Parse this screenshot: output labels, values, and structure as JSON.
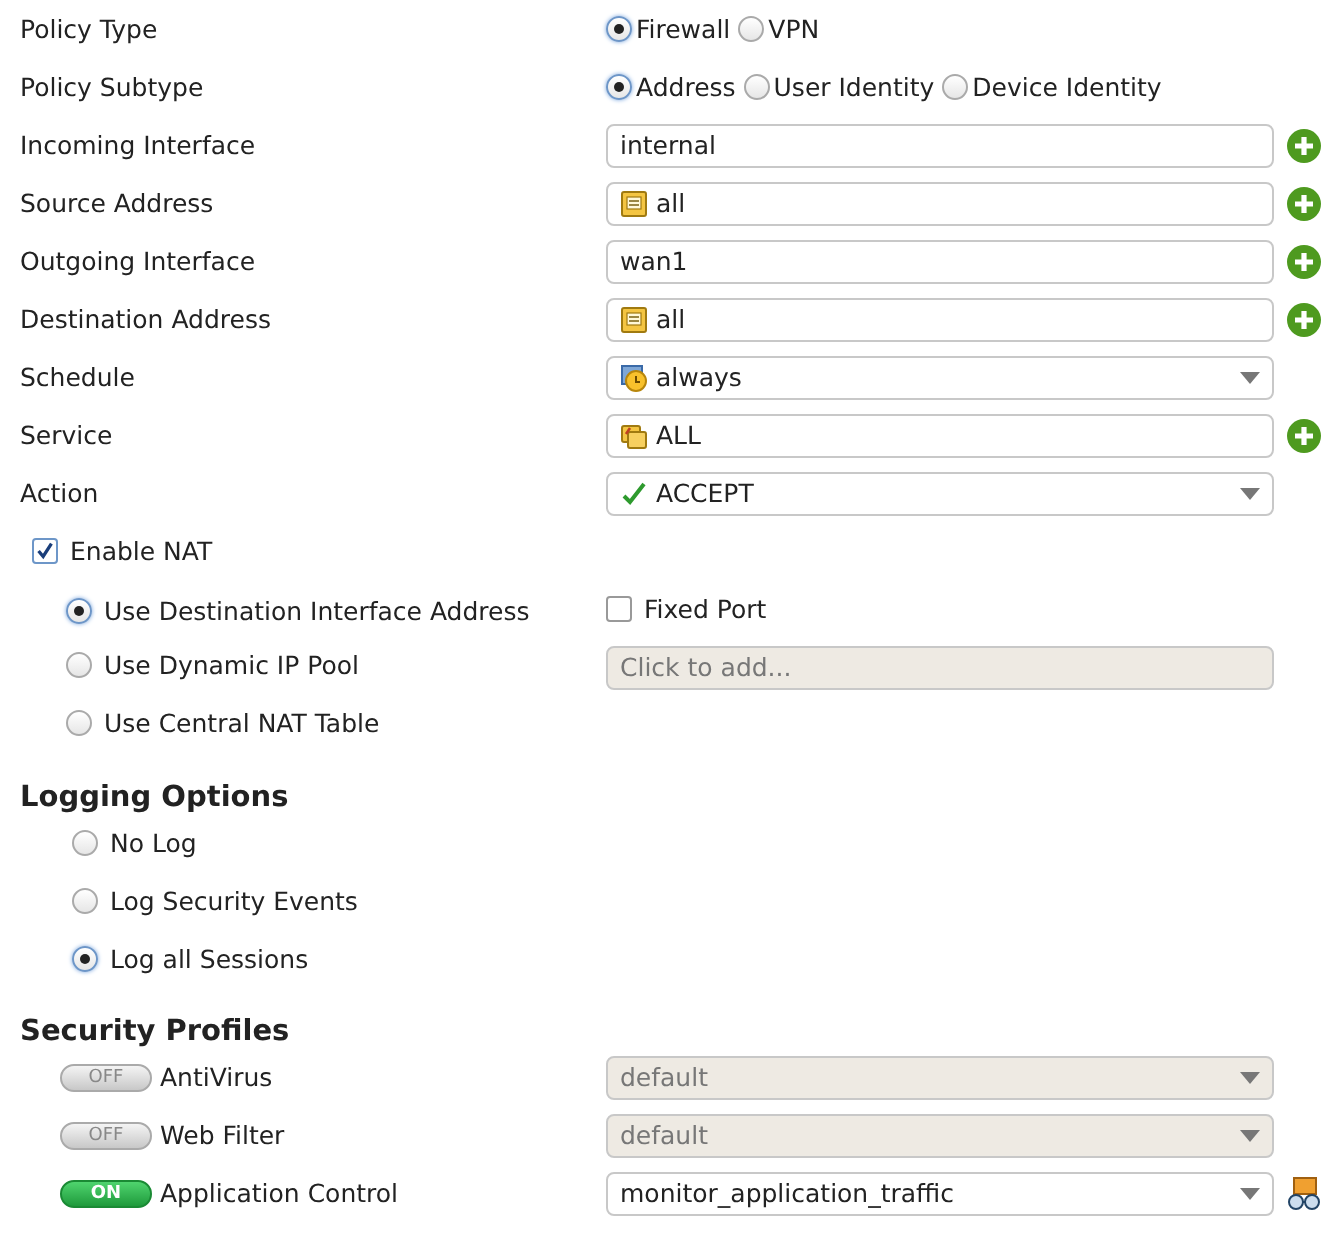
{
  "policy_type": {
    "label": "Policy Type",
    "options": [
      {
        "label": "Firewall",
        "selected": true
      },
      {
        "label": "VPN",
        "selected": false
      }
    ]
  },
  "policy_subtype": {
    "label": "Policy Subtype",
    "options": [
      {
        "label": "Address",
        "selected": true
      },
      {
        "label": "User Identity",
        "selected": false
      },
      {
        "label": "Device Identity",
        "selected": false
      }
    ]
  },
  "fields": [
    {
      "label": "Incoming Interface",
      "kind": "interface",
      "value": "internal",
      "add_button": true
    },
    {
      "label": "Source Address",
      "kind": "address",
      "value": "all",
      "add_button": true
    },
    {
      "label": "Outgoing Interface",
      "kind": "interface",
      "value": "wan1",
      "add_button": true
    },
    {
      "label": "Destination Address",
      "kind": "address",
      "value": "all",
      "add_button": true
    },
    {
      "label": "Schedule",
      "kind": "schedule",
      "value": "always",
      "add_button": false
    },
    {
      "label": "Service",
      "kind": "service",
      "value": "ALL",
      "add_button": true
    },
    {
      "label": "Action",
      "kind": "action",
      "value": "ACCEPT",
      "add_button": false
    }
  ],
  "nat": {
    "label": "Enable NAT",
    "checked": true,
    "options": [
      {
        "label": "Use Destination Interface Address",
        "selected": true
      },
      {
        "label": "Use Dynamic IP Pool",
        "selected": false
      },
      {
        "label": "Use Central NAT Table",
        "selected": false
      }
    ],
    "fixed_port": {
      "label": "Fixed Port",
      "checked": false
    },
    "pool": {
      "placeholder": "Click to add..."
    }
  },
  "logging": {
    "title": "Logging Options",
    "options": [
      {
        "label": "No Log",
        "selected": false
      },
      {
        "label": "Log Security Events",
        "selected": false
      },
      {
        "label": "Log all Sessions",
        "selected": true
      }
    ]
  },
  "security": {
    "title": "Security Profiles",
    "profiles": [
      {
        "label": "AntiVirus",
        "on": false,
        "toggle": "OFF",
        "value": "default",
        "view_icon": false
      },
      {
        "label": "Web Filter",
        "on": false,
        "toggle": "OFF",
        "value": "default",
        "view_icon": false
      },
      {
        "label": "Application Control",
        "on": true,
        "toggle": "ON",
        "value": "monitor_application_traffic",
        "view_icon": true
      }
    ]
  }
}
